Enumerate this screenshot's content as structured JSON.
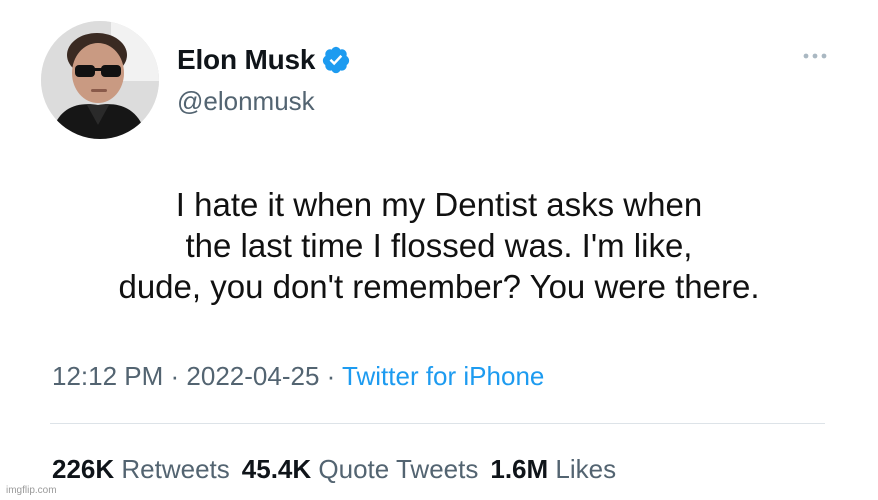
{
  "author": {
    "display_name": "Elon Musk",
    "handle": "@elonmusk",
    "verified_icon": "verified-badge-icon",
    "avatar": "profile-photo"
  },
  "tweet": {
    "lines": [
      "I hate it when my Dentist asks when",
      "the last time I flossed was. I'm like,",
      "dude, you don't remember? You were there."
    ]
  },
  "meta": {
    "time": "12:12 PM",
    "separator": " · ",
    "date": "2022-04-25",
    "source": "Twitter for iPhone"
  },
  "stats": {
    "retweets_count": "226K",
    "retweets_label": "Retweets",
    "quotes_count": "45.4K",
    "quotes_label": "Quote Tweets",
    "likes_count": "1.6M",
    "likes_label": "Likes"
  },
  "watermark": "imgflip.com",
  "colors": {
    "text": "#0f1419",
    "secondary": "#536471",
    "link": "#1d9bf0",
    "verified": "#1d9bf0"
  }
}
